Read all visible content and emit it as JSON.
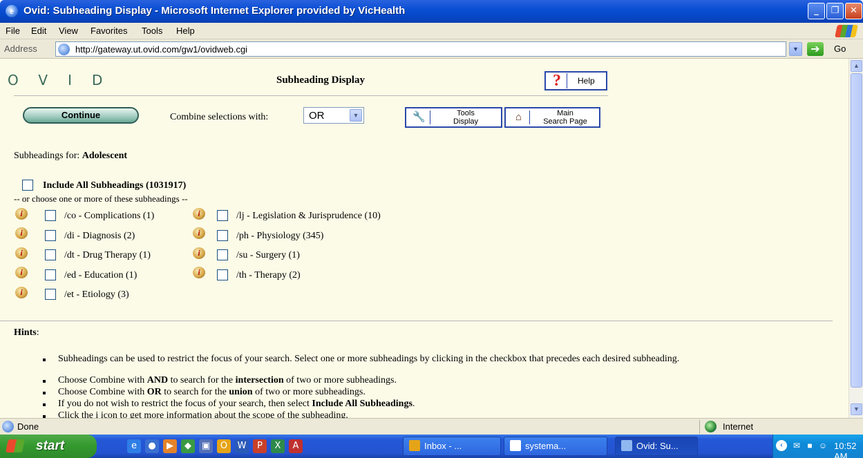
{
  "window": {
    "title": "Ovid: Subheading Display - Microsoft Internet Explorer provided by VicHealth",
    "controls": [
      "_",
      "❐",
      "✕"
    ]
  },
  "menu": [
    "File",
    "Edit",
    "View",
    "Favorites",
    "Tools",
    "Help"
  ],
  "address": {
    "label": "Address",
    "url": "http://gateway.ut.ovid.com/gw1/ovidweb.cgi",
    "go_label": "Go"
  },
  "page": {
    "logo": "OVID",
    "title": "Subheading Display",
    "help_label": "Help",
    "help_glyph": "?",
    "continue_label": "Continue",
    "combine_label": "Combine selections with:",
    "combine_value": "OR",
    "tools_label_1": "Tools",
    "tools_label_2": "Display",
    "main_label_1": "Main",
    "main_label_2": "Search Page",
    "subheadings_prefix": "Subheadings for:",
    "subject": "Adolescent",
    "include_all": "Include All Subheadings (1031917)",
    "or_choose": "-- or choose one or more of these subheadings --",
    "subheadings": [
      {
        "label": "/co - Complications (1)",
        "checked": false
      },
      {
        "label": "/lj - Legislation & Jurisprudence (10)",
        "checked": false
      },
      {
        "label": "/di - Diagnosis (2)",
        "checked": false
      },
      {
        "label": "/ph - Physiology (345)",
        "checked": false
      },
      {
        "label": "/dt - Drug Therapy (1)",
        "checked": false
      },
      {
        "label": "/su - Surgery (1)",
        "checked": false
      },
      {
        "label": "/ed - Education (1)",
        "checked": false
      },
      {
        "label": "/th - Therapy (2)",
        "checked": false
      },
      {
        "label": "/et - Etiology (3)",
        "checked": false
      }
    ],
    "info_glyph": "i",
    "hints_title": "Hints",
    "hints_colon": ":",
    "hints": [
      {
        "text": "Subheadings can be used to restrict the focus of your search. Select one or more subheadings by clicking in the checkbox that precedes each desired subheading."
      },
      {
        "pre": "Choose Combine with ",
        "b1": "AND",
        "mid": " to search for the ",
        "b2": "intersection",
        "post": " of two or more subheadings."
      },
      {
        "pre": "Choose Combine with ",
        "b1": "OR",
        "mid": " to search for the ",
        "b2": "union",
        "post": " of two or more subheadings."
      },
      {
        "pre": "If you do not wish to restrict the focus of your search, then select ",
        "b1": "Include All Subheadings",
        "post": "."
      },
      {
        "text": "Click the i icon to get more information about the scope of the subheading."
      }
    ]
  },
  "status": {
    "text": "Done",
    "zone": "Internet"
  },
  "taskbar": {
    "start_label": "start",
    "tasks": [
      {
        "label": "Inbox - ...",
        "active": false
      },
      {
        "label": "systema...",
        "active": false
      },
      {
        "label": "Ovid: Su...",
        "active": true
      }
    ],
    "clock": "10:52 AM"
  },
  "colors": {
    "content_bg": "#fcfbe8",
    "titlebar_blue": "#0a4fd4",
    "taskbar_blue": "#2458d8",
    "start_green": "#349a2f",
    "button_border": "#2a48aa"
  }
}
